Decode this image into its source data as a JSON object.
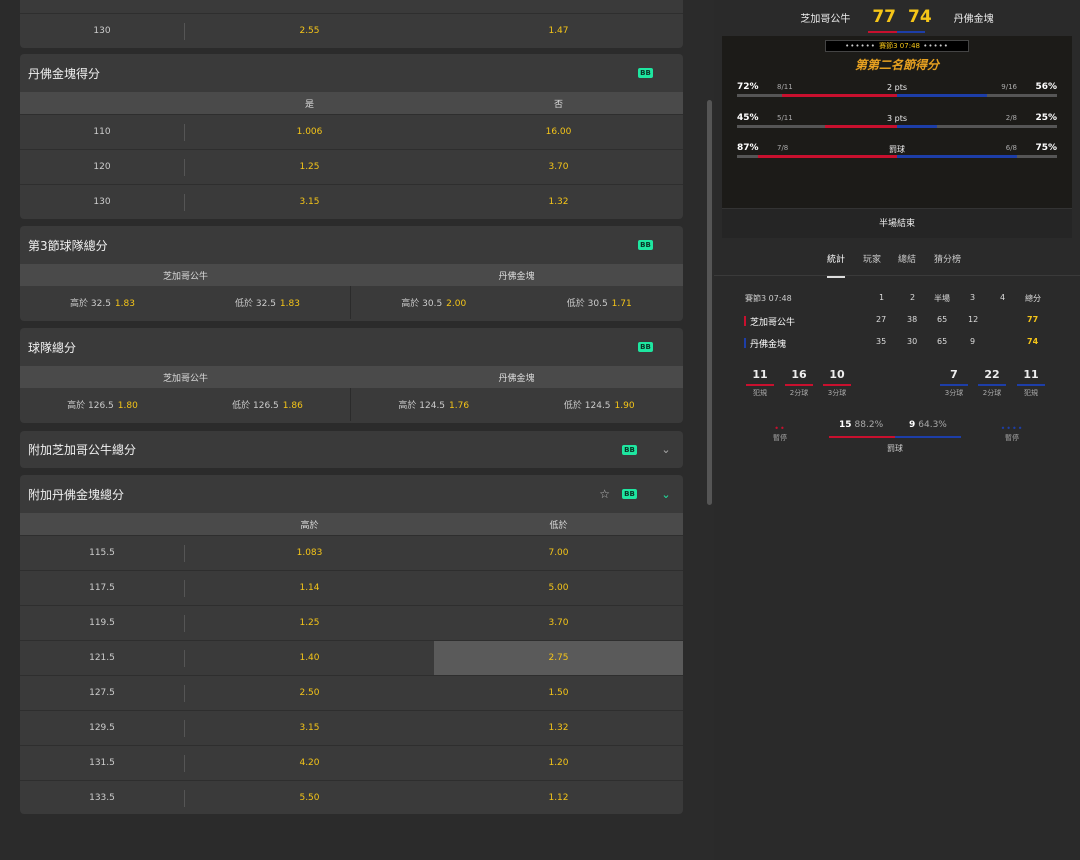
{
  "cards": {
    "partial": {
      "row": {
        "line": "130",
        "yes": "2.55",
        "no": "1.47"
      }
    },
    "den_score": {
      "title": "丹佛金塊得分",
      "badge": "BB",
      "col_yes": "是",
      "col_no": "否",
      "rows": [
        {
          "line": "110",
          "yes": "1.006",
          "no": "16.00"
        },
        {
          "line": "120",
          "yes": "1.25",
          "no": "3.70"
        },
        {
          "line": "130",
          "yes": "3.15",
          "no": "1.32"
        }
      ]
    },
    "q3_team_total": {
      "title": "第3節球隊總分",
      "badge": "BB",
      "team1": "芝加哥公牛",
      "team2": "丹佛金塊",
      "t1_over": "高於 32.5",
      "t1_over_odd": "1.83",
      "t1_under": "低於 32.5",
      "t1_under_odd": "1.83",
      "t2_over": "高於 30.5",
      "t2_over_odd": "2.00",
      "t2_under": "低於 30.5",
      "t2_under_odd": "1.71"
    },
    "team_total": {
      "title": "球隊總分",
      "badge": "BB",
      "team1": "芝加哥公牛",
      "team2": "丹佛金塊",
      "t1_over": "高於 126.5",
      "t1_over_odd": "1.80",
      "t1_under": "低於 126.5",
      "t1_under_odd": "1.86",
      "t2_over": "高於 124.5",
      "t2_over_odd": "1.76",
      "t2_under": "低於 124.5",
      "t2_under_odd": "1.90"
    },
    "chi_extra": {
      "title": "附加芝加哥公牛總分",
      "badge": "BB",
      "chevron": "⌄"
    },
    "den_extra": {
      "title": "附加丹佛金塊總分",
      "badge": "BB",
      "star": "☆",
      "chevron": "⌄",
      "col_over": "高於",
      "col_under": "低於",
      "rows": [
        {
          "line": "115.5",
          "over": "1.083",
          "under": "7.00"
        },
        {
          "line": "117.5",
          "over": "1.14",
          "under": "5.00"
        },
        {
          "line": "119.5",
          "over": "1.25",
          "under": "3.70"
        },
        {
          "line": "121.5",
          "over": "1.40",
          "under": "2.75",
          "selected": true
        },
        {
          "line": "127.5",
          "over": "2.50",
          "under": "1.50"
        },
        {
          "line": "129.5",
          "over": "3.15",
          "under": "1.32"
        },
        {
          "line": "131.5",
          "over": "4.20",
          "under": "1.20"
        },
        {
          "line": "133.5",
          "over": "5.50",
          "under": "1.12"
        }
      ]
    }
  },
  "scoreboard": {
    "home": "芝加哥公牛",
    "away": "丹佛金塊",
    "home_score": "77",
    "away_score": "74",
    "clock": "賽節3 07:48",
    "banner": "第第二名節得分",
    "stats": [
      {
        "label": "2 pts",
        "l_pct": "72%",
        "l_frac": "8/11",
        "r_frac": "9/16",
        "r_pct": "56%",
        "l_fill": 0.72,
        "r_fill": 0.56
      },
      {
        "label": "3 pts",
        "l_pct": "45%",
        "l_frac": "5/11",
        "r_frac": "2/8",
        "r_pct": "25%",
        "l_fill": 0.45,
        "r_fill": 0.25
      },
      {
        "label": "罰球",
        "l_pct": "87%",
        "l_frac": "7/8",
        "r_frac": "6/8",
        "r_pct": "75%",
        "l_fill": 0.87,
        "r_fill": 0.75
      }
    ],
    "halftime": "半場結束"
  },
  "tabs": [
    "統計",
    "玩家",
    "總結",
    "猜分榜"
  ],
  "boxscore": {
    "header": "賽節3 07:48",
    "cols": [
      "1",
      "2",
      "半場",
      "3",
      "4",
      "總分"
    ],
    "rows": [
      {
        "team": "芝加哥公牛",
        "q1": "27",
        "q2": "38",
        "half": "65",
        "q3": "12",
        "q4": "",
        "total": "77",
        "color": "#c8102e"
      },
      {
        "team": "丹佛金塊",
        "q1": "35",
        "q2": "30",
        "half": "65",
        "q3": "9",
        "q4": "",
        "total": "74",
        "color": "#1d3ea8"
      }
    ]
  },
  "team_stats": {
    "home": [
      {
        "value": "11",
        "label": "犯規"
      },
      {
        "value": "16",
        "label": "2分球"
      },
      {
        "value": "10",
        "label": "3分球"
      }
    ],
    "away": [
      {
        "value": "7",
        "label": "3分球"
      },
      {
        "value": "22",
        "label": "2分球"
      },
      {
        "value": "11",
        "label": "犯規"
      }
    ],
    "timeout_label": "暫停",
    "ft_home": "15",
    "ft_home_pct": "88.2%",
    "ft_away": "9",
    "ft_away_pct": "64.3%",
    "ft_label": "罰球"
  },
  "colors": {
    "home": "#c8102e",
    "away": "#1d3ea8",
    "odds": "#f5c518",
    "badge": "#1ee6a0"
  }
}
